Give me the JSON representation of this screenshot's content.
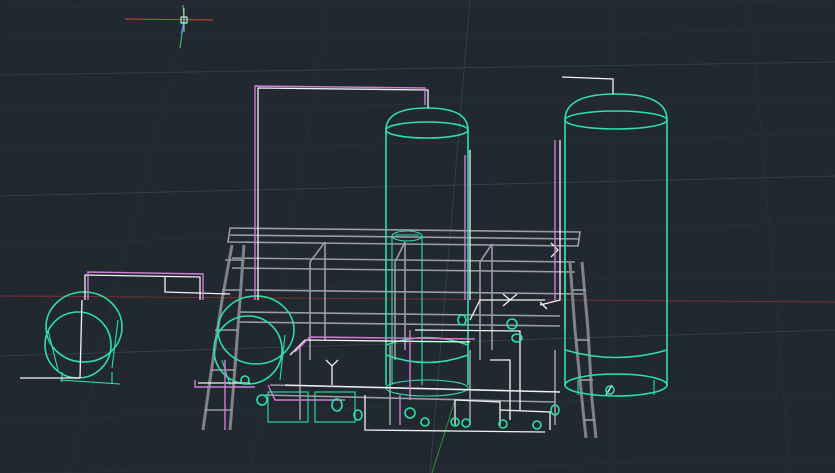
{
  "viewport": {
    "background": "#212830",
    "accent_colors": {
      "equipment": "#2ee0a8",
      "steel": "#9a9da1",
      "pipe_white": "#f2f2f2",
      "pipe_magenta": "#d27cd6",
      "x_axis": "#e0443a",
      "y_axis": "#3fcf5a",
      "z_axis": "#3b6bff"
    },
    "icons": {
      "ucs": "ucs-axis-icon",
      "cursor": "crosshair-cursor-icon"
    }
  }
}
